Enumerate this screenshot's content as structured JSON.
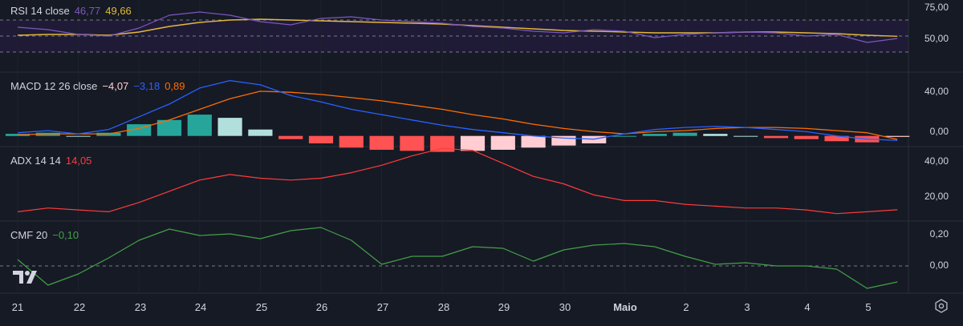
{
  "colors": {
    "background": "#161a25",
    "separator": "#2a2e39",
    "grid": "#1e222d",
    "rsi_line": "#7e57c2",
    "rsi_ma": "#e2b93b",
    "rsi_band": "#1f1b36",
    "macd_line": "#2962ff",
    "signal_line": "#ff6d00",
    "hist_up_strong": "#26a69a",
    "hist_up_weak": "#b2dfdb",
    "hist_down_strong": "#ff5252",
    "hist_down_weak": "#ffcdd2",
    "adx_line": "#ff3b3b",
    "cmf_line": "#43a047"
  },
  "panes": {
    "rsi": {
      "name": "RSI 14 close",
      "value1": "46,77",
      "value2": "49,66",
      "ticks": [
        "75,00",
        "50,00"
      ]
    },
    "macd": {
      "name": "MACD 12 26 close",
      "value1": "−4,07",
      "value2": "−3,18",
      "value3": "0,89",
      "ticks": [
        "40,00",
        "0,00"
      ]
    },
    "adx": {
      "name": "ADX 14 14",
      "value1": "14,05",
      "ticks": [
        "40,00",
        "20,00"
      ]
    },
    "cmf": {
      "name": "CMF 20",
      "value1": "−0,10",
      "ticks": [
        "0,20",
        "0,00"
      ]
    }
  },
  "x_axis": {
    "labels": [
      "21",
      "22",
      "23",
      "24",
      "25",
      "26",
      "27",
      "28",
      "29",
      "30",
      "Maio",
      "2",
      "3",
      "4",
      "5"
    ]
  },
  "chart_data": [
    {
      "type": "line",
      "x": [
        0,
        0.5,
        1,
        1.5,
        2,
        2.5,
        3,
        3.5,
        4,
        4.5,
        5,
        5.5,
        6,
        6.5,
        7,
        7.5,
        8,
        8.5,
        9,
        9.5,
        10,
        10.5,
        11,
        11.5,
        12,
        12.5,
        13,
        13.5,
        14,
        14.5
      ],
      "series": [
        {
          "values": [
            61,
            58,
            52,
            50,
            60,
            76,
            80,
            76,
            68,
            64,
            72,
            74,
            70,
            68,
            66,
            62,
            60,
            56,
            54,
            58,
            56,
            48,
            52,
            54,
            55,
            54,
            50,
            52,
            42,
            47
          ]
        },
        {
          "values": [
            51,
            52,
            52,
            51,
            55,
            62,
            67,
            70,
            71,
            70,
            69,
            68,
            67,
            66,
            65,
            63,
            61,
            59,
            57,
            56,
            55,
            54,
            54,
            54,
            55,
            55,
            54,
            53,
            51,
            49.7
          ]
        }
      ],
      "ylim": [
        5,
        95
      ]
    },
    {
      "type": "bar",
      "x": [
        0,
        0.5,
        1,
        1.5,
        2,
        2.5,
        3,
        3.5,
        4,
        4.5,
        5,
        5.5,
        6,
        6.5,
        7,
        7.5,
        8,
        8.5,
        9,
        9.5,
        10,
        10.5,
        11,
        11.5,
        12,
        12.5,
        13,
        13.5,
        14,
        14.5
      ],
      "series": [
        {
          "values": [
            3,
            5,
            2,
            6,
            18,
            30,
            45,
            52,
            48,
            38,
            32,
            25,
            20,
            15,
            10,
            6,
            3,
            0,
            -2,
            -3,
            2,
            6,
            8,
            9,
            8,
            6,
            4,
            0,
            -3,
            -4.1
          ]
        },
        {
          "values": [
            1,
            2,
            2,
            2,
            7,
            15,
            25,
            35,
            42,
            41,
            39,
            36,
            33,
            29,
            25,
            20,
            16,
            11,
            7,
            4,
            2,
            4,
            5,
            7,
            8,
            8,
            7,
            5,
            3,
            -3.2
          ]
        },
        {
          "values": [
            2,
            3,
            0,
            3,
            11,
            15,
            20,
            17,
            6,
            -3,
            -7,
            -11,
            -13,
            -14,
            -15,
            -14,
            -13,
            -11,
            -9,
            -7,
            0,
            2,
            3,
            2,
            0,
            -2,
            -3,
            -5,
            -6,
            -0.9
          ]
        }
      ],
      "ylim": [
        -10,
        60
      ]
    },
    {
      "type": "line",
      "x": [
        0,
        0.5,
        1,
        1.5,
        2,
        2.5,
        3,
        3.5,
        4,
        4.5,
        5,
        5.5,
        6,
        6.5,
        7,
        7.5,
        8,
        8.5,
        9,
        9.5,
        10,
        10.5,
        11,
        11.5,
        12,
        12.5,
        13,
        13.5,
        14,
        14.5
      ],
      "series": [
        {
          "values": [
            13,
            15,
            14,
            13,
            18,
            24,
            30,
            33,
            31,
            30,
            31,
            34,
            38,
            43,
            47,
            46,
            39,
            32,
            28,
            22,
            19,
            19,
            17,
            16,
            15,
            15,
            14,
            12,
            13,
            14.05
          ]
        }
      ],
      "ylim": [
        8,
        48
      ]
    },
    {
      "type": "line",
      "x": [
        0,
        0.5,
        1,
        1.5,
        2,
        2.5,
        3,
        3.5,
        4,
        4.5,
        5,
        5.5,
        6,
        6.5,
        7,
        7.5,
        8,
        8.5,
        9,
        9.5,
        10,
        10.5,
        11,
        11.5,
        12,
        12.5,
        13,
        13.5,
        14,
        14.5
      ],
      "series": [
        {
          "values": [
            0.04,
            -0.12,
            -0.05,
            0.05,
            0.16,
            0.23,
            0.19,
            0.2,
            0.17,
            0.22,
            0.24,
            0.16,
            0.01,
            0.06,
            0.06,
            0.12,
            0.11,
            0.03,
            0.1,
            0.13,
            0.14,
            0.12,
            0.06,
            0.01,
            0.02,
            0.0,
            0.0,
            -0.02,
            -0.14,
            -0.1
          ]
        }
      ],
      "ylim": [
        -0.17,
        0.28
      ]
    }
  ]
}
